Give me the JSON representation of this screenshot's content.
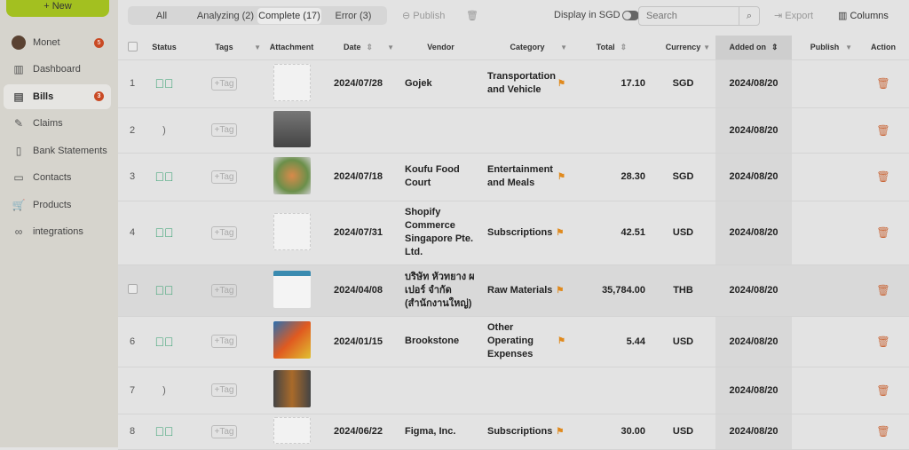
{
  "sidebar": {
    "new_label": "+ New",
    "user": {
      "name": "Monet",
      "badge": "5"
    },
    "items": [
      {
        "label": "Dashboard",
        "icon": "chart-icon"
      },
      {
        "label": "Bills",
        "icon": "receipt-icon",
        "badge": "3",
        "active": true
      },
      {
        "label": "Claims",
        "icon": "claims-icon"
      },
      {
        "label": "Bank Statements",
        "icon": "bank-statement-icon"
      },
      {
        "label": "Contacts",
        "icon": "contact-card-icon"
      },
      {
        "label": "Products",
        "icon": "cart-icon"
      },
      {
        "label": "integrations",
        "icon": "link-icon"
      }
    ]
  },
  "toolbar": {
    "tabs": [
      "All",
      "Analyzing (2)",
      "Complete (17)",
      "Error (3)"
    ],
    "active_tab": 2,
    "publish": "Publish",
    "display_sgd": "Display in SGD",
    "search_placeholder": "Search",
    "export": "Export",
    "columns": "Columns"
  },
  "table": {
    "headers": [
      "Status",
      "Tags",
      "Attachment",
      "Date",
      "Vendor",
      "Category",
      "Total",
      "Currency",
      "Added on",
      "Publish",
      "Action"
    ],
    "tag_label": "+Tag",
    "rows": [
      {
        "n": "1",
        "status": "complete",
        "date": "2024/07/28",
        "vendor": "Gojek",
        "category": "Transportation and Vehicle",
        "total": "17.10",
        "currency": "SGD",
        "added": "2024/08/20",
        "att": "document"
      },
      {
        "n": "2",
        "status": "analyzing",
        "date": "",
        "vendor": "",
        "category": "",
        "total": "",
        "currency": "",
        "added": "2024/08/20",
        "att": "photo-dark"
      },
      {
        "n": "3",
        "status": "complete",
        "date": "2024/07/18",
        "vendor": "Koufu Food Court",
        "category": "Entertainment and Meals",
        "total": "28.30",
        "currency": "SGD",
        "added": "2024/08/20",
        "att": "photo-food"
      },
      {
        "n": "4",
        "status": "complete",
        "date": "2024/07/31",
        "vendor": "Shopify Commerce Singapore Pte. Ltd.",
        "category": "Subscriptions",
        "total": "42.51",
        "currency": "USD",
        "added": "2024/08/20",
        "att": "document"
      },
      {
        "n": "",
        "status": "complete",
        "date": "2024/04/08",
        "vendor": "บริษัท หัวทยาง ผเปอร์ จำกัด (สำนักงานใหญ่)",
        "category": "Raw Materials",
        "total": "35,784.00",
        "currency": "THB",
        "added": "2024/08/20",
        "att": "invoice",
        "hover": true
      },
      {
        "n": "6",
        "status": "complete",
        "date": "2024/01/15",
        "vendor": "Brookstone",
        "category": "Other Operating Expenses",
        "total": "5.44",
        "currency": "USD",
        "added": "2024/08/20",
        "att": "photo-box"
      },
      {
        "n": "7",
        "status": "analyzing",
        "date": "",
        "vendor": "",
        "category": "",
        "total": "",
        "currency": "",
        "added": "2024/08/20",
        "att": "photo-bottle"
      },
      {
        "n": "8",
        "status": "complete",
        "date": "2024/06/22",
        "vendor": "Figma, Inc.",
        "category": "Subscriptions",
        "total": "30.00",
        "currency": "USD",
        "added": "2024/08/20",
        "att": "document"
      }
    ]
  },
  "colors": {
    "accent": "#a3c020",
    "badge": "#c94a24",
    "status_ok": "#2e9e6b",
    "flag": "#e08a1e",
    "trash": "#c9683a"
  }
}
